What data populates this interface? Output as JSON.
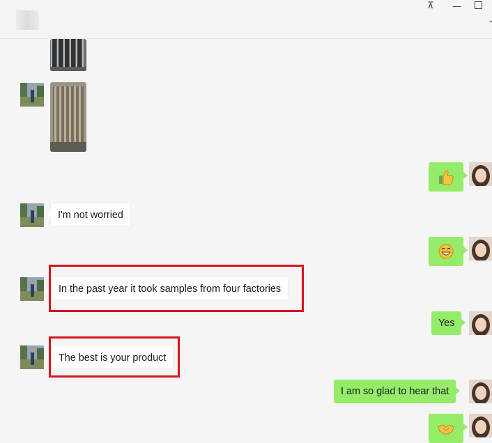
{
  "window": {
    "controls": {
      "pin": "⊼",
      "minimize": "—",
      "more": "⌄"
    }
  },
  "colors": {
    "outgoing_bubble": "#95ec69",
    "incoming_bubble": "#ffffff",
    "highlight": "#d7141f",
    "background": "#f5f5f5"
  },
  "messages": [
    {
      "side": "in",
      "type": "image",
      "content": "pipe-stack-photo"
    },
    {
      "side": "in",
      "type": "image",
      "content": "pipe-bundle-photo"
    },
    {
      "side": "out",
      "type": "emoji",
      "icon": "thumbs-up-icon"
    },
    {
      "side": "in",
      "type": "text",
      "text": "I'm not worried"
    },
    {
      "side": "out",
      "type": "emoji",
      "icon": "grin-icon"
    },
    {
      "side": "in",
      "type": "text",
      "text": "In the past year it took samples from four factories",
      "highlighted": true
    },
    {
      "side": "out",
      "type": "text",
      "text": "Yes"
    },
    {
      "side": "in",
      "type": "text",
      "text": "The best is your product",
      "highlighted": true
    },
    {
      "side": "out",
      "type": "text",
      "text": "I am so glad to hear that"
    },
    {
      "side": "out",
      "type": "emoji",
      "icon": "handshake-icon"
    }
  ]
}
